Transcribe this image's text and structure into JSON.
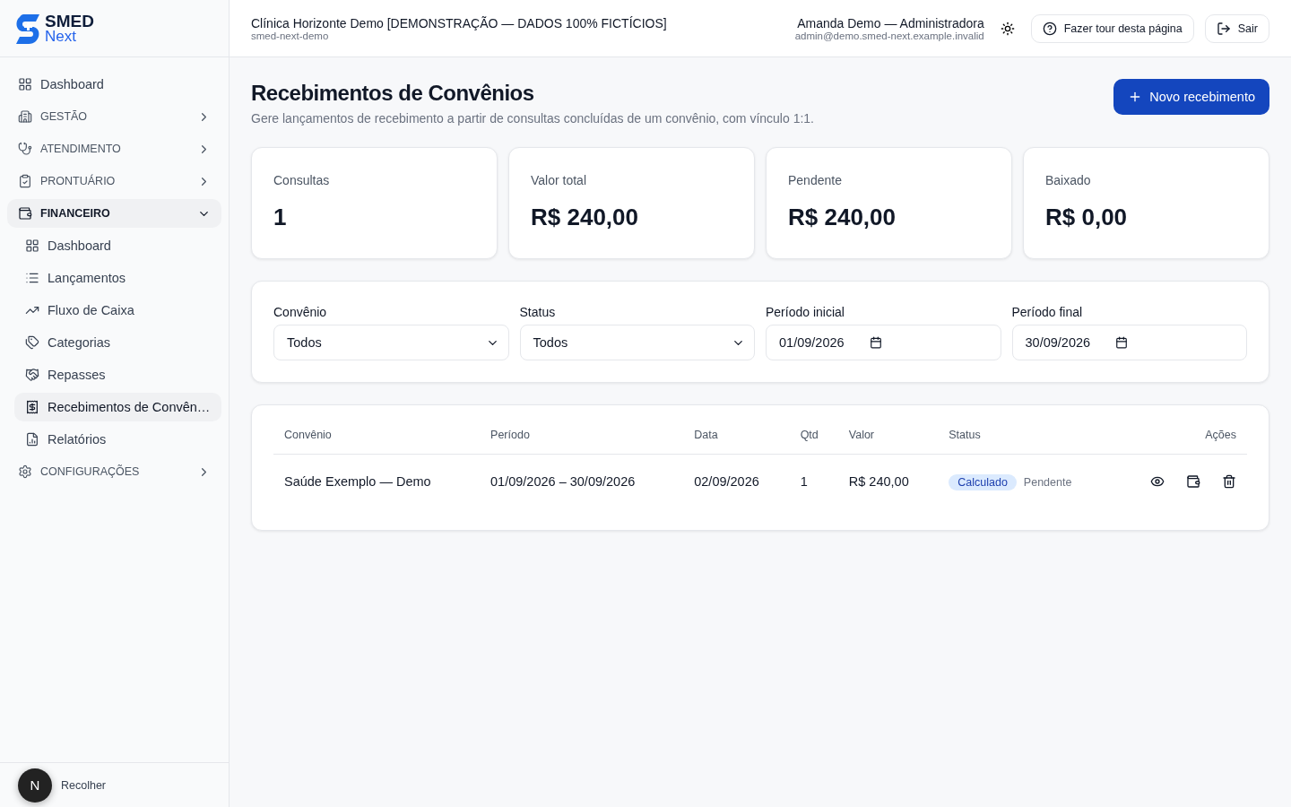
{
  "brand": {
    "name": "SMED",
    "sub": "Next"
  },
  "header": {
    "clinic": "Clínica Horizonte Demo [DEMONSTRAÇÃO — DADOS 100% FICTÍCIOS]",
    "slug": "smed-next-demo",
    "user": "Amanda Demo — Administradora",
    "email": "admin@demo.smed-next.example.invalid",
    "tour_button": "Fazer tour desta página",
    "logout_button": "Sair"
  },
  "sidebar": {
    "items": [
      {
        "kind": "link",
        "label": "Dashboard",
        "selected": false
      },
      {
        "kind": "section",
        "label": "GESTÃO",
        "expanded": false
      },
      {
        "kind": "section",
        "label": "ATENDIMENTO",
        "expanded": false
      },
      {
        "kind": "section",
        "label": "PRONTUÁRIO",
        "expanded": false
      },
      {
        "kind": "section",
        "label": "FINANCEIRO",
        "expanded": true,
        "children": [
          {
            "label": "Dashboard",
            "selected": false
          },
          {
            "label": "Lançamentos",
            "selected": false
          },
          {
            "label": "Fluxo de Caixa",
            "selected": false
          },
          {
            "label": "Categorias",
            "selected": false
          },
          {
            "label": "Repasses",
            "selected": false
          },
          {
            "label": "Recebimentos de Convên…",
            "selected": true
          },
          {
            "label": "Relatórios",
            "selected": false
          }
        ]
      },
      {
        "kind": "section",
        "label": "CONFIGURAÇÕES",
        "expanded": false
      }
    ],
    "collapse": "Recolher",
    "avatar": "N"
  },
  "page": {
    "title": "Recebimentos de Convênios",
    "subtitle": "Gere lançamentos de recebimento a partir de consultas concluídas de um convênio, com vínculo 1:1.",
    "new_button": "Novo recebimento"
  },
  "stats": [
    {
      "label": "Consultas",
      "value": "1"
    },
    {
      "label": "Valor total",
      "value": "R$ 240,00"
    },
    {
      "label": "Pendente",
      "value": "R$ 240,00"
    },
    {
      "label": "Baixado",
      "value": "R$ 0,00"
    }
  ],
  "filters": [
    {
      "kind": "select",
      "label": "Convênio",
      "value": "Todos"
    },
    {
      "kind": "select",
      "label": "Status",
      "value": "Todos"
    },
    {
      "kind": "date",
      "label": "Período inicial",
      "value": "01/09/2026"
    },
    {
      "kind": "date",
      "label": "Período final",
      "value": "30/09/2026"
    }
  ],
  "table": {
    "columns": [
      "Convênio",
      "Período",
      "Data",
      "Qtd",
      "Valor",
      "Status",
      "Ações"
    ],
    "rows": [
      {
        "convenio": "Saúde Exemplo — Demo",
        "periodo": "01/09/2026 – 30/09/2026",
        "data": "02/09/2026",
        "qtd": "1",
        "valor": "R$ 240,00",
        "status": "Calculado",
        "payment": "Pendente"
      }
    ]
  }
}
